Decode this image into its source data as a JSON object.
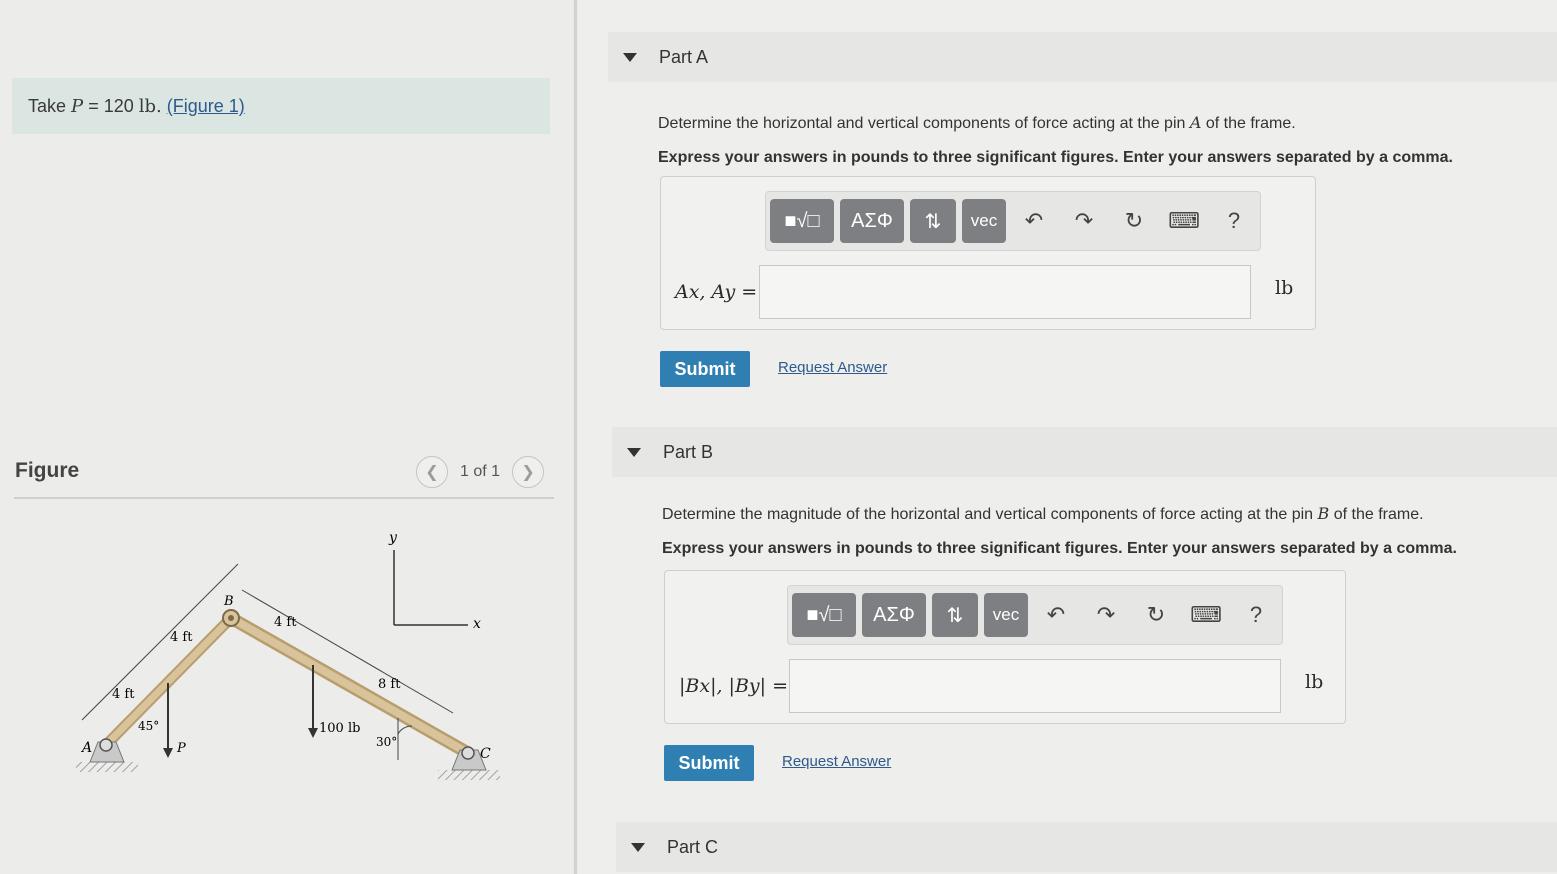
{
  "problem": {
    "take_prefix": "Take",
    "variable": "P",
    "equals": "= 120",
    "unit": "lb.",
    "figure_link": "(Figure 1)"
  },
  "figure": {
    "heading": "Figure",
    "pager_text": "1 of 1",
    "labels": {
      "point_a": "A",
      "point_b": "B",
      "point_c": "C",
      "load_p": "P",
      "load_100": "100 lb",
      "dim_4ft_1": "4 ft",
      "dim_4ft_2": "4 ft",
      "dim_4ft_3": "4 ft",
      "dim_8ft": "8 ft",
      "angle_45": "45°",
      "angle_30": "30°",
      "axis_x": "x",
      "axis_y": "y"
    }
  },
  "parts": [
    {
      "title": "Part A",
      "question_pre": "Determine the horizontal and vertical components of force acting at the pin",
      "question_var": "A",
      "question_post": "of the frame.",
      "instruction": "Express your answers in pounds to three significant figures. Enter your answers separated by a comma.",
      "answer_label": "Ax, Ay =",
      "answer_value": "",
      "unit": "lb",
      "submit": "Submit",
      "request": "Request Answer"
    },
    {
      "title": "Part B",
      "question_pre": "Determine the magnitude of the horizontal and vertical components of force acting at the pin",
      "question_var": "B",
      "question_post": "of the frame.",
      "instruction": "Express your answers in pounds to three significant figures. Enter your answers separated by a comma.",
      "answer_label": "|Bx|, |By| =",
      "answer_value": "",
      "unit": "lb",
      "submit": "Submit",
      "request": "Request Answer"
    },
    {
      "title": "Part C"
    }
  ],
  "toolbar": {
    "templates": "■√□",
    "greek": "ΑΣΦ",
    "arrows": "⇅",
    "vec": "vec",
    "help": "?",
    "icons": [
      "templates-icon",
      "greek-symbols-icon",
      "sort-arrows-icon",
      "vector-icon",
      "undo-icon",
      "redo-icon",
      "reset-icon",
      "keyboard-icon",
      "help-icon"
    ]
  }
}
